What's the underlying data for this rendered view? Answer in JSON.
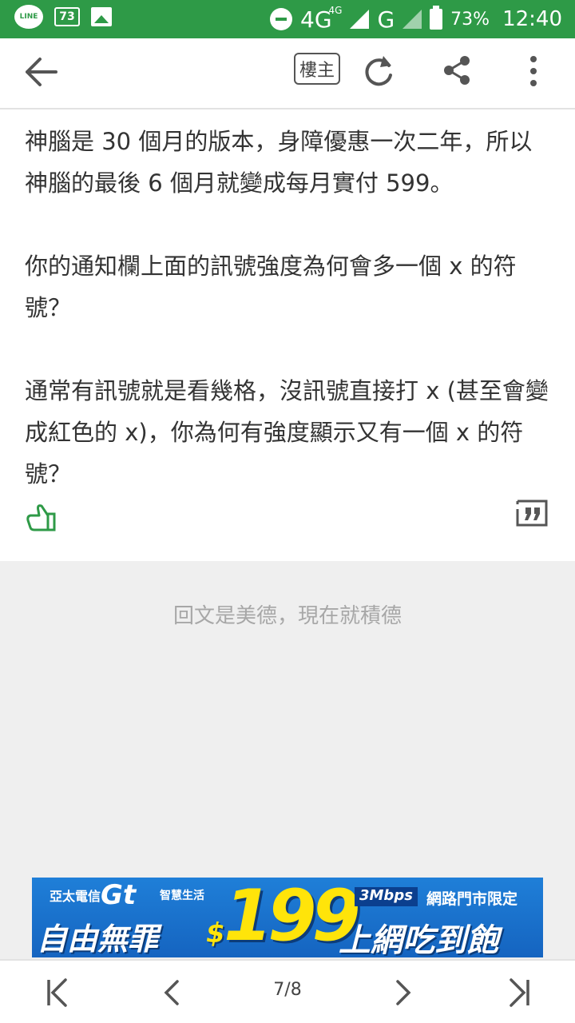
{
  "status_bar": {
    "line_label": "LINE",
    "calendar_badge": "73",
    "network": "4G",
    "network_sup": "4G",
    "network2": "G",
    "battery_pct": "73%",
    "time": "12:40"
  },
  "toolbar": {
    "author_filter_label": "樓主"
  },
  "post": {
    "paragraphs": [
      "神腦是 30 個月的版本，身障優惠一次二年，所以神腦的最後 6 個月就變成每月實付 599。",
      "你的通知欄上面的訊號強度為何會多一個 x 的符號？",
      "通常有訊號就是看幾格，沒訊號直接打 x (甚至會變成紅色的 x)，你為何有強度顯示又有一個 x 的符號？"
    ]
  },
  "reply_prompt": "回文是美德，現在就積德",
  "ad": {
    "brand": "亞太電信",
    "logo": "Gt",
    "sub": "智慧生活",
    "speed": "3Mbps",
    "store": "網路門市限定",
    "main": "自由無罪",
    "dollar": "$",
    "price": "199",
    "tail": "上網吃到飽"
  },
  "pager": {
    "current": "7/8"
  },
  "colors": {
    "status_bar": "#2e9a47",
    "like_icon": "#2e9a47",
    "background_grey": "#efefef"
  }
}
